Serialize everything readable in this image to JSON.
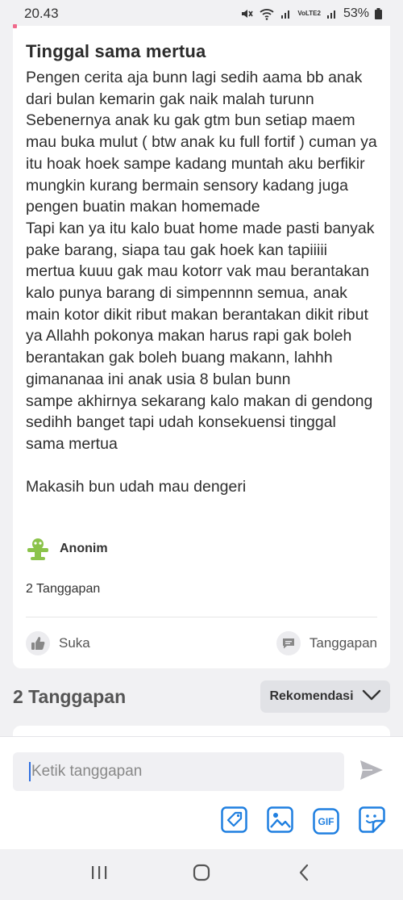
{
  "status_bar": {
    "time": "20.43",
    "battery": "53%",
    "network_label": "VoLTE2"
  },
  "post": {
    "title": "Tinggal sama mertua",
    "body": "Pengen cerita aja bunn lagi sedih aama bb anak dari bulan kemarin gak naik malah turunn\nSebenernya anak ku gak gtm bun setiap maem mau buka mulut ( btw anak ku full fortif ) cuman ya itu hoak hoek sampe kadang muntah aku berfikir mungkin kurang bermain sensory kadang juga pengen buatin makan homemade\nTapi kan ya itu kalo buat home made pasti banyak pake barang, siapa tau gak hoek kan tapiiiii mertua kuuu gak mau kotorr vak mau berantakan kalo punya barang di simpennnn semua, anak main kotor dikit ribut makan berantakan dikit ribut ya Allahh pokonya makan harus rapi gak boleh berantakan gak boleh buang makann, lahhh gimananaa ini anak usia 8 bulan bunn\nsampe akhirnya sekarang kalo makan di gendong sedihh banget tapi udah konsekuensi tinggal sama mertua\n\nMakasih bun udah mau dengeri",
    "author": "Anonim",
    "response_count": "2 Tanggapan",
    "like_label": "Suka",
    "reply_label": "Tanggapan"
  },
  "responses": {
    "header": "2 Tanggapan",
    "sort_label": "Rekomendasi"
  },
  "composer": {
    "placeholder": "Ketik tanggapan",
    "tools": [
      "tag-icon",
      "image-icon",
      "gif-icon",
      "sticker-icon"
    ],
    "gif_label": "GIF"
  },
  "colors": {
    "accent": "#1f7fe0",
    "avatar": "#8bc34a",
    "background": "#f1f1f3"
  }
}
